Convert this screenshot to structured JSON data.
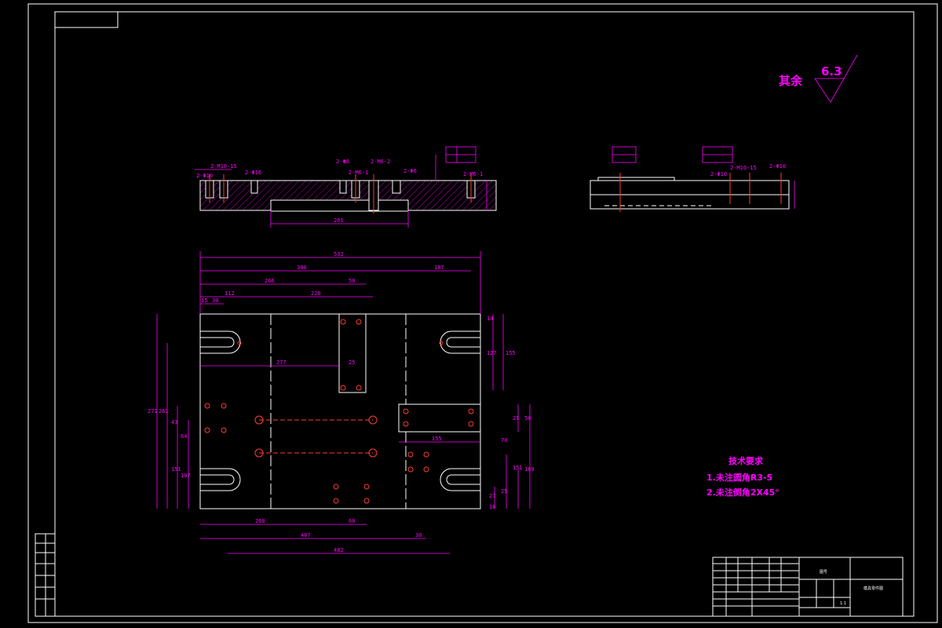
{
  "surface_finish": {
    "label": "其余",
    "value": "6.3"
  },
  "tech_requirements": {
    "title": "技术要求",
    "items": [
      "1.未注圆角R3-5",
      "2.未注倒角2X45°"
    ]
  },
  "front_view": {
    "callouts": [
      "2-M10-15",
      "2-Φ10",
      "2-Φ16",
      "2-Φ8",
      "2-M6-1",
      "2-M6-2",
      "2-Φ6",
      "2-M6-1"
    ],
    "dimensions": [
      "261"
    ]
  },
  "side_view": {
    "callouts": [
      "2-M10-15",
      "2-Φ10",
      "2-Φ10"
    ]
  },
  "plan_view": {
    "dimensions": {
      "total_width": "532",
      "left_span": "380",
      "right_span": "187",
      "span_266": "266",
      "span_50": "50",
      "span_112": "112",
      "span_220": "220",
      "span_15": "15",
      "span_30": "30",
      "span_277": "277",
      "span_25": "25",
      "span_260": "260",
      "span_60": "60",
      "span_407": "407",
      "span_30b": "30",
      "span_482": "482",
      "span_155": "155",
      "h_14": "14",
      "h_127": "127",
      "h_155": "155",
      "h_25": "25",
      "h_50": "50",
      "h_70": "70",
      "h_151": "151",
      "h_169": "169",
      "h_271": "271",
      "h_261": "261",
      "h_43": "43",
      "h_64": "64",
      "h_107": "107",
      "h_151b": "151",
      "h_25b": "25",
      "h_27": "27",
      "h_16": "16"
    }
  },
  "title_block": {
    "drawing_name": "模具零件图",
    "small_label": "图号",
    "scale": "1:1"
  }
}
